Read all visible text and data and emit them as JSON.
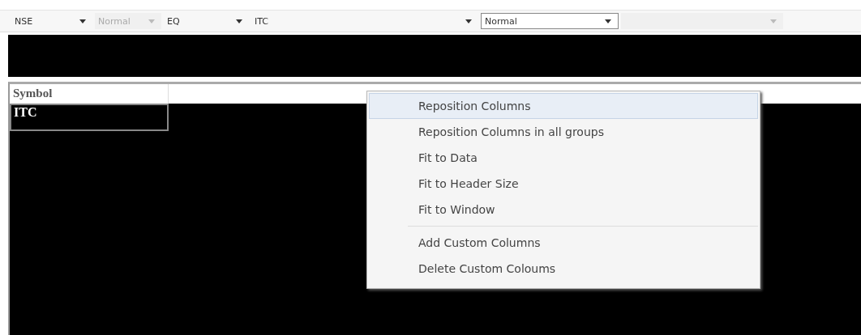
{
  "toolbar": {
    "dropdowns": [
      {
        "value": "NSE",
        "disabled": false,
        "focused": false
      },
      {
        "value": "Normal",
        "disabled": true,
        "focused": false
      },
      {
        "value": "EQ",
        "disabled": false,
        "focused": false
      },
      {
        "value": "ITC",
        "disabled": false,
        "focused": false
      },
      {
        "value": "Normal",
        "disabled": false,
        "focused": true
      },
      {
        "disabled": true,
        "focused": false
      }
    ]
  },
  "table": {
    "columns": [
      "Symbol"
    ],
    "rows": [
      {
        "cells": [
          "ITC"
        ],
        "selected": true
      }
    ]
  },
  "context_menu": {
    "groups": [
      [
        {
          "label": "Reposition Columns",
          "selected": true
        },
        {
          "label": "Reposition Columns in all groups",
          "selected": false
        },
        {
          "label": "Fit to Data",
          "selected": false
        },
        {
          "label": "Fit to Header Size",
          "selected": false
        },
        {
          "label": "Fit to Window",
          "selected": false
        }
      ],
      [
        {
          "label": "Add Custom Columns",
          "selected": false
        },
        {
          "label": "Delete Custom Coloums",
          "selected": false
        }
      ]
    ]
  }
}
